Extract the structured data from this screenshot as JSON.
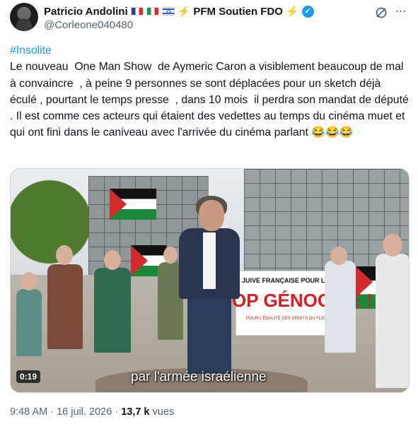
{
  "author": {
    "name": "Patricio Andolini",
    "name_suffix": "PFM Soutien FDO",
    "handle": "@Corleone040480",
    "bolt": "⚡"
  },
  "icons": {
    "flags": [
      "flag-fr-icon",
      "flag-it-icon",
      "flag-il-icon"
    ],
    "verified": "verified-badge-icon",
    "grok": "grok-icon",
    "more": "more-icon"
  },
  "tweet": {
    "hashtag": "#Insolite",
    "body": "Le nouveau  One Man Show  de Aymeric Caron a visiblement beaucoup de mal à convaincre  , à peine 9 personnes se sont déplacées pour un sketch déjà  éculé , pourtant le temps presse  , dans 10 mois  il perdra son mandat de député . Il est comme ces acteurs qui étaient des vedettes au temps du cinéma muet et qui ont fini dans le caniveau avec l'arrivée du cinéma parlant 😂😂😂"
  },
  "video": {
    "duration": "0:19",
    "subtitle": "par l'armée israélienne",
    "banner_top": "JUIVE FRANÇAISE POUR LA PAIX",
    "banner_main": "OP GÉNOCIDE !",
    "banner_sub": "POUR L'ÉGALITÉ DES DROITS DU FLEUVE À LA MER"
  },
  "footer": {
    "time": "9:48 AM",
    "separator": " · ",
    "date": "16 juil. 2026",
    "views_count": "13,7 k",
    "views_label": " vues"
  },
  "colors": {
    "accent": "#1d9bf0",
    "text": "#0f1419",
    "secondary": "#536471"
  }
}
